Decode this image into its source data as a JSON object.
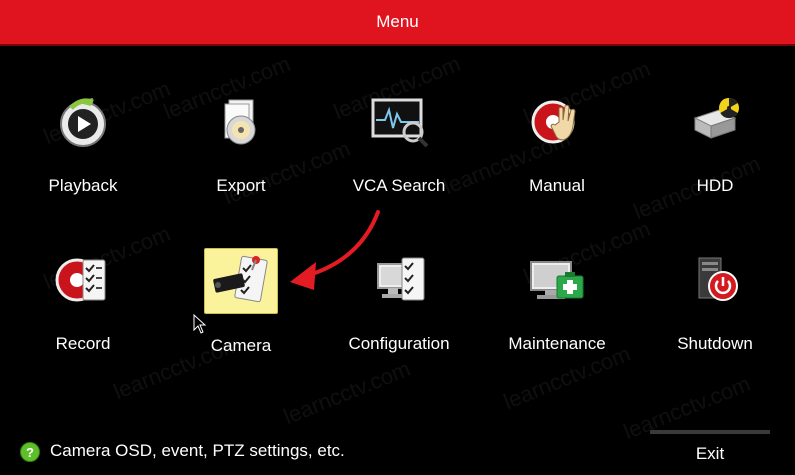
{
  "window": {
    "title": "Menu"
  },
  "watermark": {
    "text": "learncctv.com"
  },
  "menu": {
    "items": [
      {
        "id": "playback",
        "label": "Playback",
        "icon": "playback-icon"
      },
      {
        "id": "export",
        "label": "Export",
        "icon": "export-disc-icon"
      },
      {
        "id": "vca-search",
        "label": "VCA Search",
        "icon": "vca-search-icon"
      },
      {
        "id": "manual",
        "label": "Manual",
        "icon": "manual-record-hand-icon"
      },
      {
        "id": "hdd",
        "label": "HDD",
        "icon": "hdd-icon"
      },
      {
        "id": "record",
        "label": "Record",
        "icon": "record-icon"
      },
      {
        "id": "camera",
        "label": "Camera",
        "icon": "camera-settings-icon",
        "selected": true
      },
      {
        "id": "configuration",
        "label": "Configuration",
        "icon": "configuration-icon"
      },
      {
        "id": "maintenance",
        "label": "Maintenance",
        "icon": "maintenance-icon"
      },
      {
        "id": "shutdown",
        "label": "Shutdown",
        "icon": "shutdown-icon"
      }
    ]
  },
  "status": {
    "hint": "Camera OSD, event, PTZ settings, etc.",
    "help_icon": "?",
    "exit_label": "Exit"
  },
  "colors": {
    "titlebar": "#e0141e",
    "background": "#000000",
    "selected_tile": "#fbf29c",
    "annotation_arrow": "#e31b23"
  }
}
